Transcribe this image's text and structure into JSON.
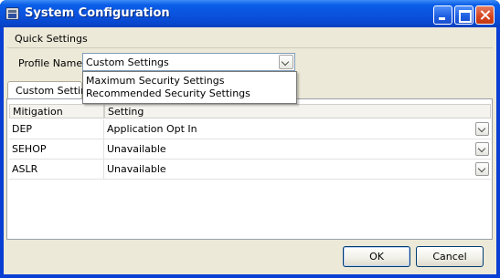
{
  "window": {
    "title": "System Configuration",
    "controls": [
      "minimize",
      "maximize",
      "close"
    ]
  },
  "quick_settings": {
    "group_label": "Quick Settings",
    "profile_label": "Profile Name",
    "profile_value": "Custom Settings",
    "dropdown_options": [
      "Maximum Security Settings",
      "Recommended Security Settings"
    ]
  },
  "tab": {
    "label": "Custom Setting"
  },
  "table": {
    "columns": [
      "Mitigation",
      "Setting"
    ],
    "rows": [
      {
        "mitigation": "DEP",
        "setting": "Application Opt In"
      },
      {
        "mitigation": "SEHOP",
        "setting": "Unavailable"
      },
      {
        "mitigation": "ASLR",
        "setting": "Unavailable"
      }
    ]
  },
  "buttons": {
    "ok": "OK",
    "cancel": "Cancel"
  },
  "colors": {
    "titlebar": "#0a52dd",
    "client_bg": "#ece9d8",
    "close_button": "#d5431c"
  }
}
